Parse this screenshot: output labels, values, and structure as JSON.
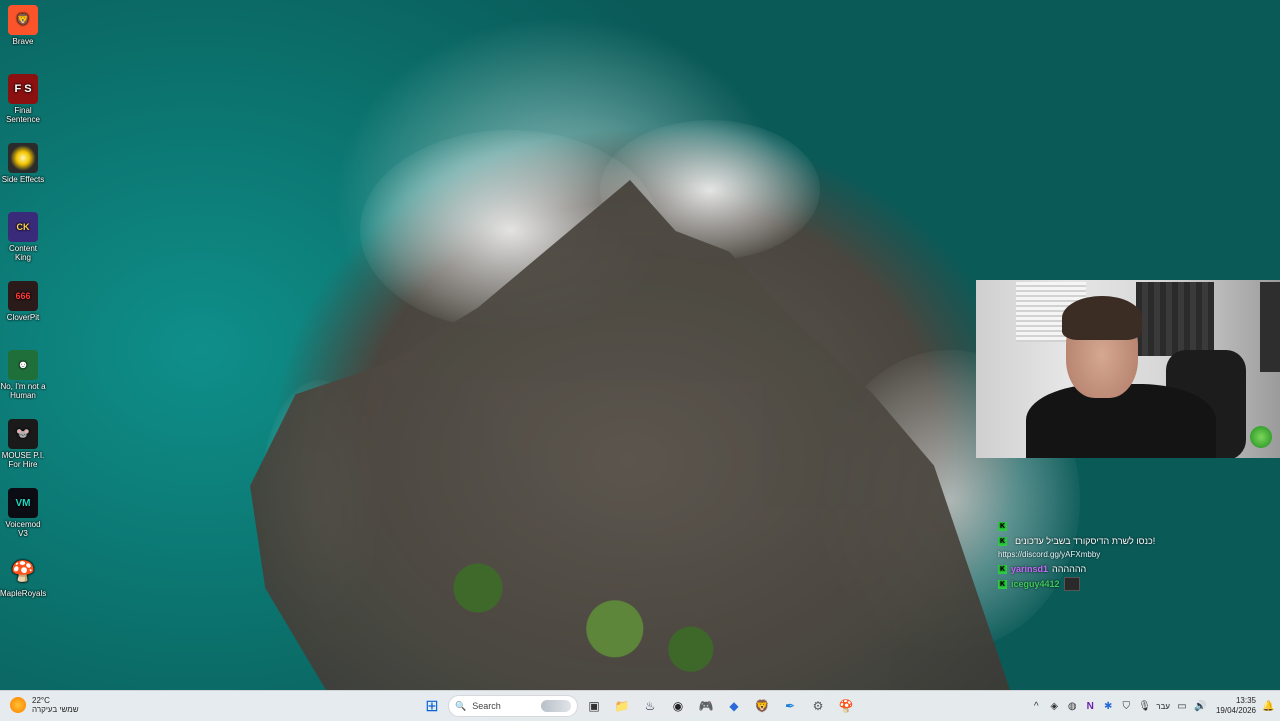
{
  "desktop": {
    "icons": [
      {
        "label": "Brave",
        "icon": "brave-lion-icon",
        "glyph": "🦁",
        "color": "#fb542b"
      },
      {
        "label": "Final Sentence",
        "icon": "final-sentence-icon",
        "glyph": "F S",
        "color": "#8b1010"
      },
      {
        "label": "Side Effects",
        "icon": "side-effects-icon",
        "glyph": "●",
        "color": "#2b2b2b"
      },
      {
        "label": "Content King",
        "icon": "content-king-icon",
        "glyph": "CK",
        "color": "#3a2a7a"
      },
      {
        "label": "CloverPit",
        "icon": "cloverpit-icon",
        "glyph": "666",
        "color": "#2a1a1a"
      },
      {
        "label": "No, I'm not a Human",
        "icon": "no-im-not-a-human-icon",
        "glyph": "☻",
        "color": "#1f6f3a"
      },
      {
        "label": "MOUSE P.I. For Hire",
        "icon": "mouse-pi-icon",
        "glyph": "🐭",
        "color": "#1a1a1a"
      },
      {
        "label": "Voicemod V3",
        "icon": "voicemod-icon",
        "glyph": "VM",
        "color": "#0c0c14"
      },
      {
        "label": "MapleRoyals",
        "icon": "mushroom-icon",
        "glyph": "🍄",
        "color": "#d86a1a"
      }
    ]
  },
  "chat": {
    "lines": [
      {
        "user": "",
        "text": "",
        "sub": ""
      },
      {
        "user": "",
        "text": "כנסו לשרת הדיסקורד בשביל עדכונים!",
        "sub": "https://discord.gg/yAFXmbby"
      },
      {
        "user": "yarinsd1",
        "text": "הההההה",
        "sub": ""
      },
      {
        "user": "iceguy4412",
        "text": "",
        "sub": ""
      }
    ]
  },
  "taskbar": {
    "weather": {
      "temp": "22°C",
      "desc": "שמשי בעיקרה"
    },
    "search_placeholder": "Search",
    "apps": [
      {
        "icon": "windows-start-icon",
        "glyph": "⊞"
      },
      {
        "icon": "task-view-icon",
        "glyph": "▣"
      },
      {
        "icon": "file-explorer-icon",
        "glyph": "📁"
      },
      {
        "icon": "steam-icon",
        "glyph": "♨"
      },
      {
        "icon": "obs-icon",
        "glyph": "◉"
      },
      {
        "icon": "discord-icon",
        "glyph": "🎮"
      },
      {
        "icon": "gem-app-icon",
        "glyph": "◆"
      },
      {
        "icon": "brave-browser-icon",
        "glyph": "🦁"
      },
      {
        "icon": "feather-app-icon",
        "glyph": "✒"
      },
      {
        "icon": "settings-icon",
        "glyph": "⚙"
      },
      {
        "icon": "maple-mushroom-icon",
        "glyph": "🍄"
      }
    ],
    "tray": {
      "language": "עבר",
      "time": "13:35",
      "date": "19/04/2026"
    }
  }
}
